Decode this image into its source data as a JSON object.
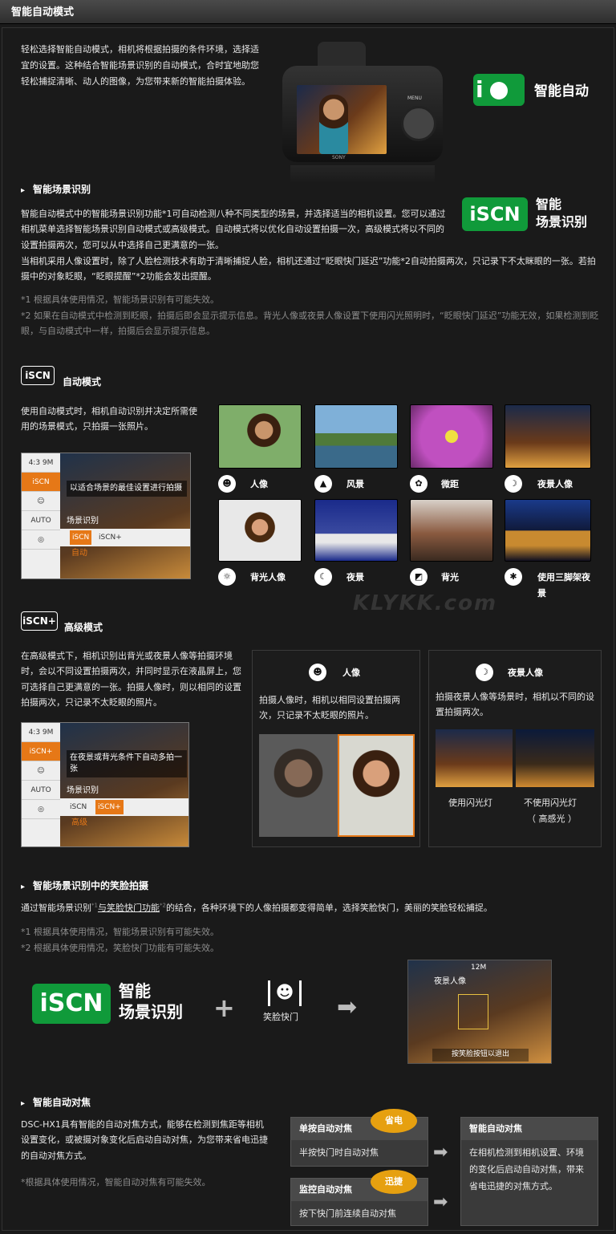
{
  "header": {
    "title": "智能自动模式"
  },
  "intro": {
    "text": "轻松选择智能自动模式，相机将根据拍摄的条件环境，选择适宜的设置。这种结合智能场景识别的自动模式，合时宜地助您轻松捕捉清晰、动人的图像，为您带来新的智能拍摄体验。",
    "logo_label": "智能自动",
    "camera_brand": "SONY",
    "camera_menu": "MENU"
  },
  "scene_recognition": {
    "heading": "智能场景识别",
    "p1": "智能自动模式中的智能场景识别功能*1可自动检测八种不同类型的场景，并选择适当的相机设置。您可以通过相机菜单选择智能场景识别自动模式或高级模式。自动模式将以优化自动设置拍摄一次，高级模式将以不同的设置拍摄两次，您可以从中选择自己更满意的一张。",
    "p2": "当相机采用人像设置时，除了人脸检测技术有助于清晰捕捉人脸，相机还通过“眨眼快门延迟”功能*2自动拍摄两次，只记录下不太眯眼的一张。若拍摄中的对象眨眼，“眨眼提醒”*2功能会发出提醒。",
    "note1": "*1 根据具体使用情况，智能场景识别有可能失效。",
    "note2": "*2 如果在自动模式中检测到眨眼，拍摄后即会显示提示信息。背光人像或夜景人像设置下使用闪光照明时，“眨眼快门延迟”功能无效，如果检测到眨眼，与自动模式中一样，拍摄后会显示提示信息。",
    "logo_text": "iSCN",
    "logo_label1": "智能",
    "logo_label2": "场景识别"
  },
  "auto_mode": {
    "badge": "iSCN",
    "title": "自动模式",
    "text": "使用自动模式时，相机自动识别并决定所需使用的场景模式，只拍摄一张照片。",
    "menu": {
      "side": [
        "4:3 9M",
        "iSCN",
        "☺",
        "AUTO",
        "◎"
      ],
      "popup": "以适合场景的最佳设置进行拍摄",
      "row1": "场景识别",
      "opt1": "iSCN",
      "opt2": "iSCN+",
      "row2": "自动"
    },
    "scenes": [
      {
        "icon": "portrait-icon",
        "label": "人像"
      },
      {
        "icon": "landscape-icon",
        "label": "风景"
      },
      {
        "icon": "macro-icon",
        "label": "微距"
      },
      {
        "icon": "night-portrait-icon",
        "label": "夜景人像"
      },
      {
        "icon": "backlight-portrait-icon",
        "label": "背光人像"
      },
      {
        "icon": "night-icon",
        "label": "夜景"
      },
      {
        "icon": "backlight-icon",
        "label": "背光"
      },
      {
        "icon": "tripod-night-icon",
        "label": "使用三脚架夜景"
      }
    ]
  },
  "advanced_mode": {
    "badge": "iSCN+",
    "title": "高级模式",
    "text": "在高级模式下，相机识别出背光或夜景人像等拍摄环境时，会以不同设置拍摄两次，并同时显示在液晶屏上，您可选择自己更满意的一张。拍摄人像时，则以相同的设置拍摄两次，只记录不太眨眼的照片。",
    "menu": {
      "side": [
        "4:3 9M",
        "iSCN+",
        "☺",
        "AUTO",
        "◎"
      ],
      "popup": "在夜景或背光条件下自动多拍一张",
      "row1": "场景识别",
      "opt1": "iSCN",
      "opt2": "iSCN+",
      "row2": "高级"
    },
    "portrait_box": {
      "title": "人像",
      "text": "拍摄人像时，相机以相同设置拍摄两次，只记录不太眨眼的照片。"
    },
    "night_box": {
      "title": "夜景人像",
      "text": "拍摄夜景人像等场景时，相机以不同的设置拍摄两次。",
      "cap1": "使用闪光灯",
      "cap2a": "不使用闪光灯",
      "cap2b": "（ 高感光 ）"
    }
  },
  "smile": {
    "heading": "智能场景识别中的笑脸拍摄",
    "text_a": "通过智能场景识别",
    "sup1": "*1",
    "text_b": "与笑脸快门功能",
    "sup2": "*2",
    "text_c": "的结合，各种环境下的人像拍摄都变得简单，选择笑脸快门，美丽的笑脸轻松捕捉。",
    "note1": "*1 根据具体使用情况，智能场景识别有可能失效。",
    "note2": "*2 根据具体使用情况，笑脸快门功能有可能失效。",
    "logo_text": "iSCN",
    "logo_label1": "智能",
    "logo_label2": "场景识别",
    "plus": "+",
    "smile_label": "笑脸快门",
    "screen_scene": "夜景人像",
    "screen_hint": "按笑脸按钮以退出",
    "screen_top": "12M"
  },
  "af": {
    "heading": "智能自动对焦",
    "text": "DSC-HX1具有智能的自动对焦方式，能够在检测到焦距等相机设置变化，或被摄对象变化后启动自动对焦，为您带来省电迅捷的自动对焦方式。",
    "note": "*根据具体使用情况，智能自动对焦有可能失效。",
    "box1": {
      "title": "单按自动对焦",
      "bubble": "省电",
      "text": "半按快门时自动对焦"
    },
    "box2": {
      "title": "监控自动对焦",
      "bubble": "迅捷",
      "text": "按下快门前连续自动对焦"
    },
    "box3": {
      "title": "智能自动对焦",
      "text": "在相机检测到相机设置、环境的变化后启动自动对焦，带来省电迅捷的对焦方式。"
    }
  },
  "watermark": {
    "line1": "KLYKK.com"
  }
}
